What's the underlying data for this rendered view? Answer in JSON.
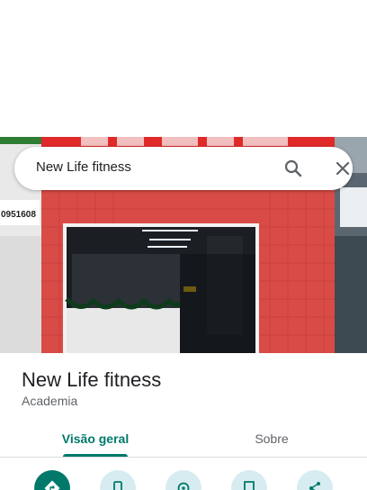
{
  "search": {
    "query": "New Life fitness",
    "search_icon": "search-icon",
    "clear_icon": "close-icon"
  },
  "place": {
    "name": "New Life fitness",
    "category": "Academia"
  },
  "tabs": [
    {
      "label": "Visão geral",
      "active": true
    },
    {
      "label": "Sobre",
      "active": false
    }
  ],
  "actions": [
    {
      "icon": "directions-icon"
    },
    {
      "icon": "phone-icon"
    },
    {
      "icon": "location-icon"
    },
    {
      "icon": "save-icon"
    },
    {
      "icon": "share-icon"
    }
  ],
  "photo": {
    "sign_phone_text": "0951608"
  },
  "colors": {
    "accent": "#00796b",
    "action_bg": "#d6ecf0"
  }
}
